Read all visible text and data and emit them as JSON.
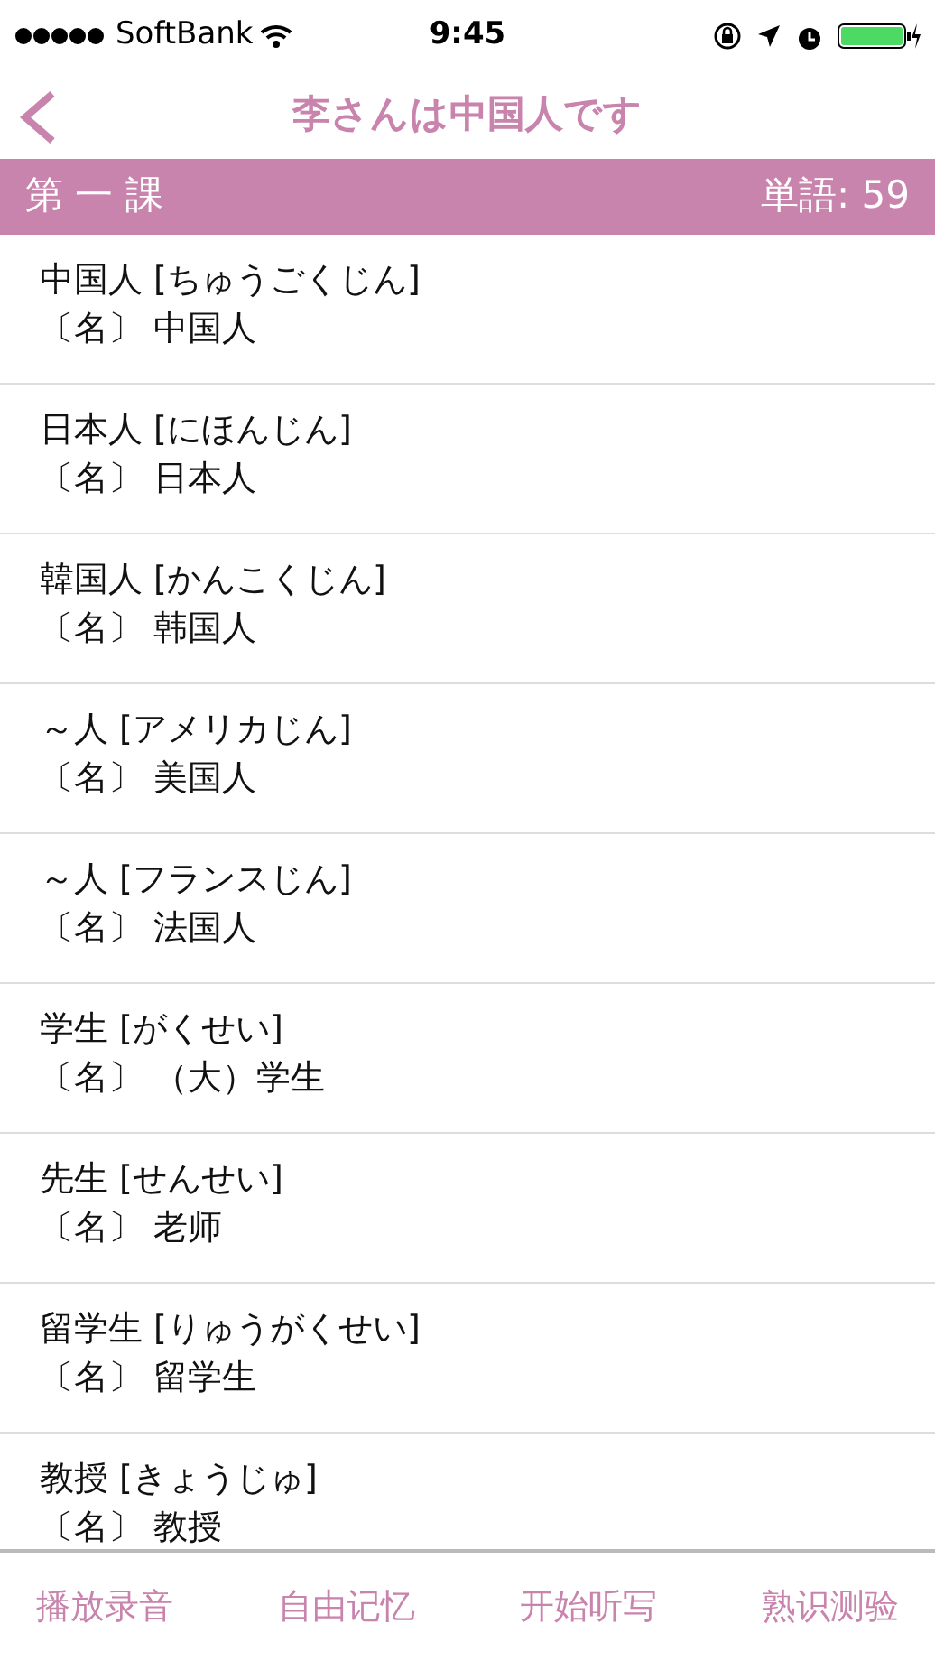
{
  "status_bar": {
    "carrier": "SoftBank",
    "time": "9:45"
  },
  "nav": {
    "title": "李さんは中国人です"
  },
  "section": {
    "title": "第 一 課",
    "count": "単語: 59"
  },
  "words": [
    {
      "word": "中国人 [ちゅうごくじん]",
      "meaning": "〔名〕 中国人"
    },
    {
      "word": "日本人 [にほんじん]",
      "meaning": "〔名〕 日本人"
    },
    {
      "word": "韓国人 [かんこくじん]",
      "meaning": "〔名〕 韩国人"
    },
    {
      "word": "～人 [アメリカじん]",
      "meaning": "〔名〕 美国人"
    },
    {
      "word": "～人 [フランスじん]",
      "meaning": "〔名〕 法国人"
    },
    {
      "word": "学生 [がくせい]",
      "meaning": "〔名〕 （大）学生"
    },
    {
      "word": "先生 [せんせい]",
      "meaning": "〔名〕 老师"
    },
    {
      "word": "留学生 [りゅうがくせい]",
      "meaning": "〔名〕 留学生"
    },
    {
      "word": "教授 [きょうじゅ]",
      "meaning": "〔名〕 教授"
    }
  ],
  "toolbar": [
    "播放录音",
    "自由记忆",
    "开始听写",
    "熟识测验"
  ]
}
